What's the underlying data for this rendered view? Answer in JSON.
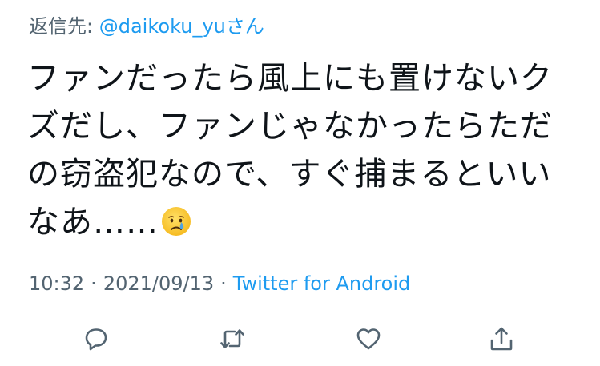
{
  "reply": {
    "prefix": "返信先:",
    "handle": "@daikoku_yuさん"
  },
  "tweet": {
    "lines": [
      "ファンだったら風上にも置けないク",
      "ズだし、ファンじゃなかったらただ",
      "の窃盗犯なので、すぐ捕まるといい",
      "なあ……"
    ],
    "emoji": "crying-face-emoji"
  },
  "meta": {
    "time": "10:32",
    "separator": "·",
    "date": "2021/09/13",
    "separator2": "·",
    "source": "Twitter for Android"
  },
  "actions": {
    "reply_icon": "reply-icon",
    "retweet_icon": "retweet-icon",
    "like_icon": "heart-icon",
    "share_icon": "share-icon"
  },
  "colors": {
    "text": "#0f1419",
    "secondary": "#536471",
    "link": "#1d9bf0",
    "emoji_face": "#fcc21b",
    "emoji_tear": "#4fa3e0"
  }
}
